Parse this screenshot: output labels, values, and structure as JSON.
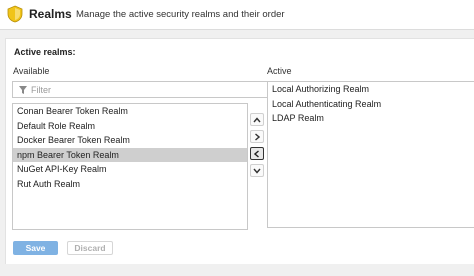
{
  "header": {
    "title": "Realms",
    "subtitle": "Manage the active security realms and their order",
    "icon": "shield-icon",
    "icon_color": "#f0c419"
  },
  "panel": {
    "section_title": "Active realms:",
    "available_label": "Available",
    "active_label": "Active",
    "filter_placeholder": "Filter",
    "available_items": [
      "Conan Bearer Token Realm",
      "Default Role Realm",
      "Docker Bearer Token Realm",
      "npm Bearer Token Realm",
      "NuGet API-Key Realm",
      "Rut Auth Realm"
    ],
    "selected_available": "npm Bearer Token Realm",
    "active_items": [
      "Local Authorizing Realm",
      "Local Authenticating Realm",
      "LDAP Realm"
    ],
    "arrow_buttons": [
      "move-up",
      "move-right",
      "move-left",
      "move-down"
    ]
  },
  "actions": {
    "save_label": "Save",
    "discard_label": "Discard",
    "save_color": "#7fb2e3"
  }
}
